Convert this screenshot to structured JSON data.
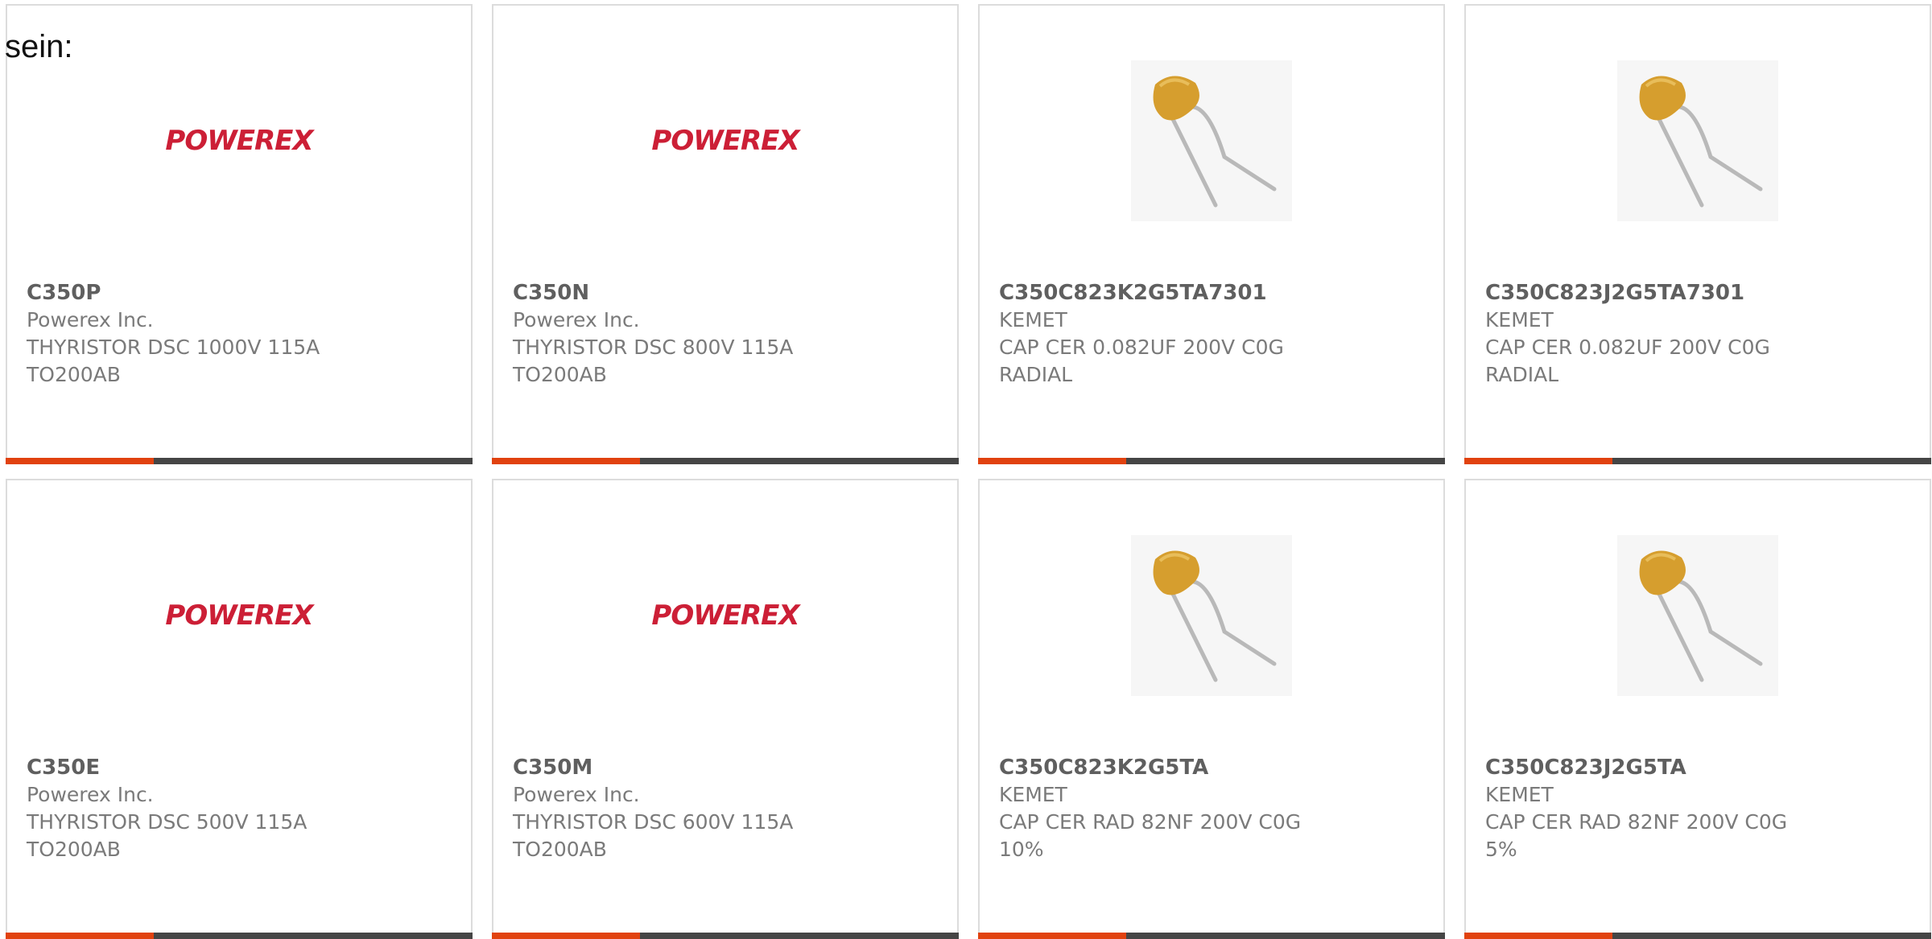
{
  "lead_text": "sein:",
  "colors": {
    "accent": "#e1420f",
    "bar": "#454545",
    "logo_red": "#cc1f36",
    "cap_body": "#d69e2e"
  },
  "products": [
    {
      "part": "C350P",
      "maker": "Powerex Inc.",
      "desc1": "THYRISTOR DSC 1000V 115A",
      "desc2": "TO200AB",
      "image": "powerex-logo",
      "logo_text": "POWEREX"
    },
    {
      "part": "C350N",
      "maker": "Powerex Inc.",
      "desc1": "THYRISTOR DSC 800V 115A",
      "desc2": "TO200AB",
      "image": "powerex-logo",
      "logo_text": "POWEREX"
    },
    {
      "part": "C350C823K2G5TA7301",
      "maker": "KEMET",
      "desc1": "CAP CER 0.082UF 200V C0G",
      "desc2": "RADIAL",
      "image": "radial-capacitor-photo"
    },
    {
      "part": "C350C823J2G5TA7301",
      "maker": "KEMET",
      "desc1": "CAP CER 0.082UF 200V C0G",
      "desc2": "RADIAL",
      "image": "radial-capacitor-photo"
    },
    {
      "part": "C350E",
      "maker": "Powerex Inc.",
      "desc1": "THYRISTOR DSC 500V 115A",
      "desc2": "TO200AB",
      "image": "powerex-logo",
      "logo_text": "POWEREX"
    },
    {
      "part": "C350M",
      "maker": "Powerex Inc.",
      "desc1": "THYRISTOR DSC 600V 115A",
      "desc2": "TO200AB",
      "image": "powerex-logo",
      "logo_text": "POWEREX"
    },
    {
      "part": "C350C823K2G5TA",
      "maker": "KEMET",
      "desc1": "CAP CER RAD 82NF 200V C0G",
      "desc2": "10%",
      "image": "radial-capacitor-photo"
    },
    {
      "part": "C350C823J2G5TA",
      "maker": "KEMET",
      "desc1": "CAP CER RAD 82NF 200V C0G",
      "desc2": "5%",
      "image": "radial-capacitor-photo"
    }
  ]
}
